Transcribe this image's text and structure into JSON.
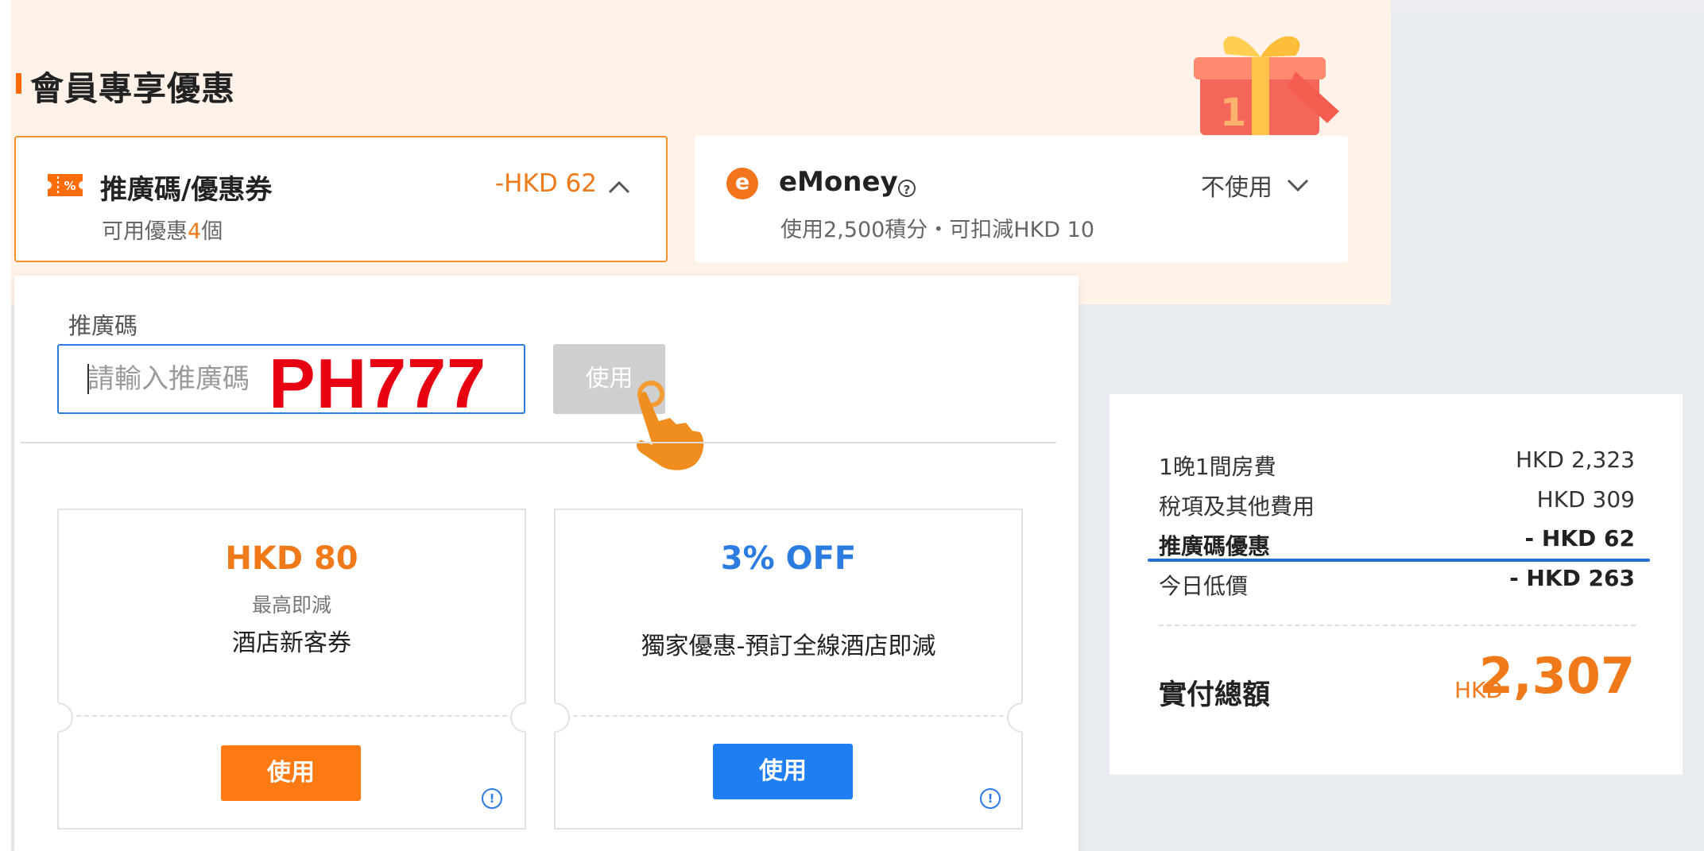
{
  "member": {
    "title": "會員專享優惠"
  },
  "promo_card": {
    "title": "推廣碼/優惠券",
    "discount": "-HKD 62",
    "sub_prefix": "可用優惠",
    "sub_count": "4",
    "sub_suffix": "個",
    "icon_text": "%"
  },
  "emoney_card": {
    "title": "eMoney",
    "status": "不使用",
    "sub": "使用2,500積分・可扣減HKD 10"
  },
  "promo_section": {
    "label": "推廣碼",
    "placeholder": "請輸入推廣碼",
    "overlay_code": "PH777",
    "apply_label": "使用"
  },
  "coupons": [
    {
      "amount": "HKD 80",
      "note": "最高即減",
      "name": "酒店新客券",
      "button": "使用",
      "accent": "#f07a1a",
      "button_color": "#ff7a13"
    },
    {
      "amount": "3% OFF",
      "name": "獨家優惠-預訂全線酒店即減",
      "button": "使用",
      "accent": "#2b7be0",
      "button_color": "#1e7ef2"
    }
  ],
  "summary": {
    "rows": [
      {
        "label": "1晚1間房費",
        "value": "HKD 2,323"
      },
      {
        "label": "稅項及其他費用",
        "value": "HKD 309"
      },
      {
        "label": "推廣碼優惠",
        "value": "- HKD 62"
      },
      {
        "label": "今日低價",
        "value": "- HKD 263"
      }
    ],
    "total_label": "實付總額",
    "total_currency": "HKD",
    "total_value": "2,307"
  },
  "colors": {
    "accent_orange": "#f07a1a",
    "accent_blue": "#2b7be0",
    "overlay_red": "#e60012"
  }
}
